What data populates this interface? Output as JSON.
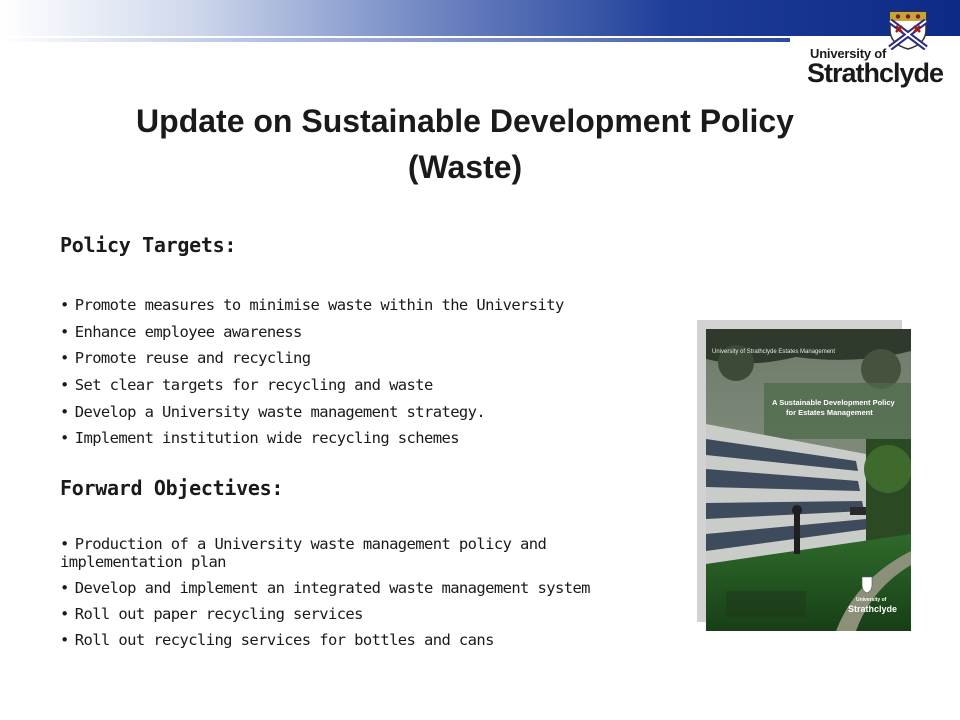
{
  "header": {
    "logo": {
      "line1": "University of",
      "line2": "Strathclyde"
    }
  },
  "title": {
    "line1": "Update on Sustainable Development Policy",
    "line2": "(Waste)"
  },
  "policy_targets": {
    "heading": "Policy Targets:",
    "items": [
      "Promote measures to minimise waste within the University",
      "Enhance employee awareness",
      "Promote reuse and recycling",
      "Set clear targets for recycling and waste",
      "Develop a University waste management strategy.",
      "Implement institution wide recycling schemes"
    ]
  },
  "forward_objectives": {
    "heading": "Forward Objectives:",
    "items": [
      "Production of a University waste management policy and implementation plan",
      "Develop and implement an integrated waste management system",
      "Roll out paper recycling services",
      "Roll out recycling services for bottles and cans"
    ]
  },
  "cover_image": {
    "header_text": "University of Strathclyde Estates Management",
    "title_line1": "A Sustainable Development Policy",
    "title_line2": "for Estates Management",
    "footer_line1": "University of",
    "footer_line2": "Strathclyde"
  },
  "colors": {
    "title_text": "#1a1a1a",
    "banner_dark": "#0c2a86",
    "banner_light": "#ffffff"
  }
}
